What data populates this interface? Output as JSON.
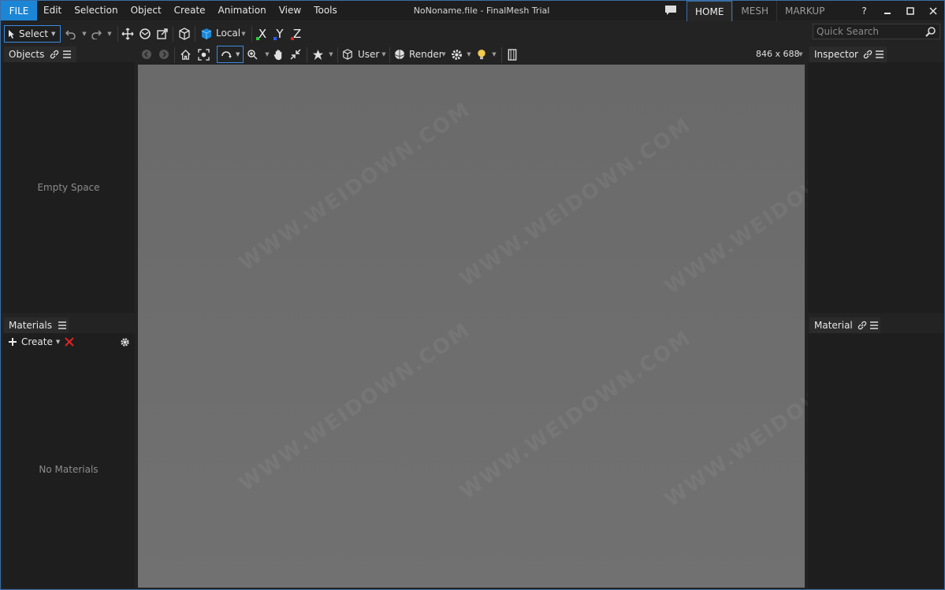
{
  "title_bar": {
    "file_label": "FILE",
    "menu": [
      "Edit",
      "Selection",
      "Object",
      "Create",
      "Animation",
      "View",
      "Tools"
    ],
    "document_title": "NoNoname.file - FinalMesh  Trial",
    "tabs": [
      "HOME",
      "MESH",
      "MARKUP"
    ],
    "active_tab": "HOME",
    "help_label": "?"
  },
  "toolbar": {
    "select_label": "Select",
    "coord_space_label": "Local",
    "axis_x": "X",
    "axis_y": "Y",
    "axis_z": "Z",
    "quick_search_placeholder": "Quick Search"
  },
  "objects_panel": {
    "title": "Objects",
    "empty_text": "Empty Space"
  },
  "materials_panel": {
    "title": "Materials",
    "create_label": "Create",
    "empty_text": "No Materials"
  },
  "viewport_toolbar": {
    "camera_label": "User",
    "render_label": "Render",
    "size_label": "846 x 688"
  },
  "inspector_panel": {
    "title": "Inspector"
  },
  "material_panel": {
    "title": "Material"
  },
  "colors": {
    "accent": "#1c86d6",
    "axis_x": "#2ecc40",
    "axis_y": "#2d5bff",
    "axis_z": "#e02424",
    "viewport": "#6d6d6d"
  },
  "watermark_text": "WWW.WEIDOWN.COM"
}
